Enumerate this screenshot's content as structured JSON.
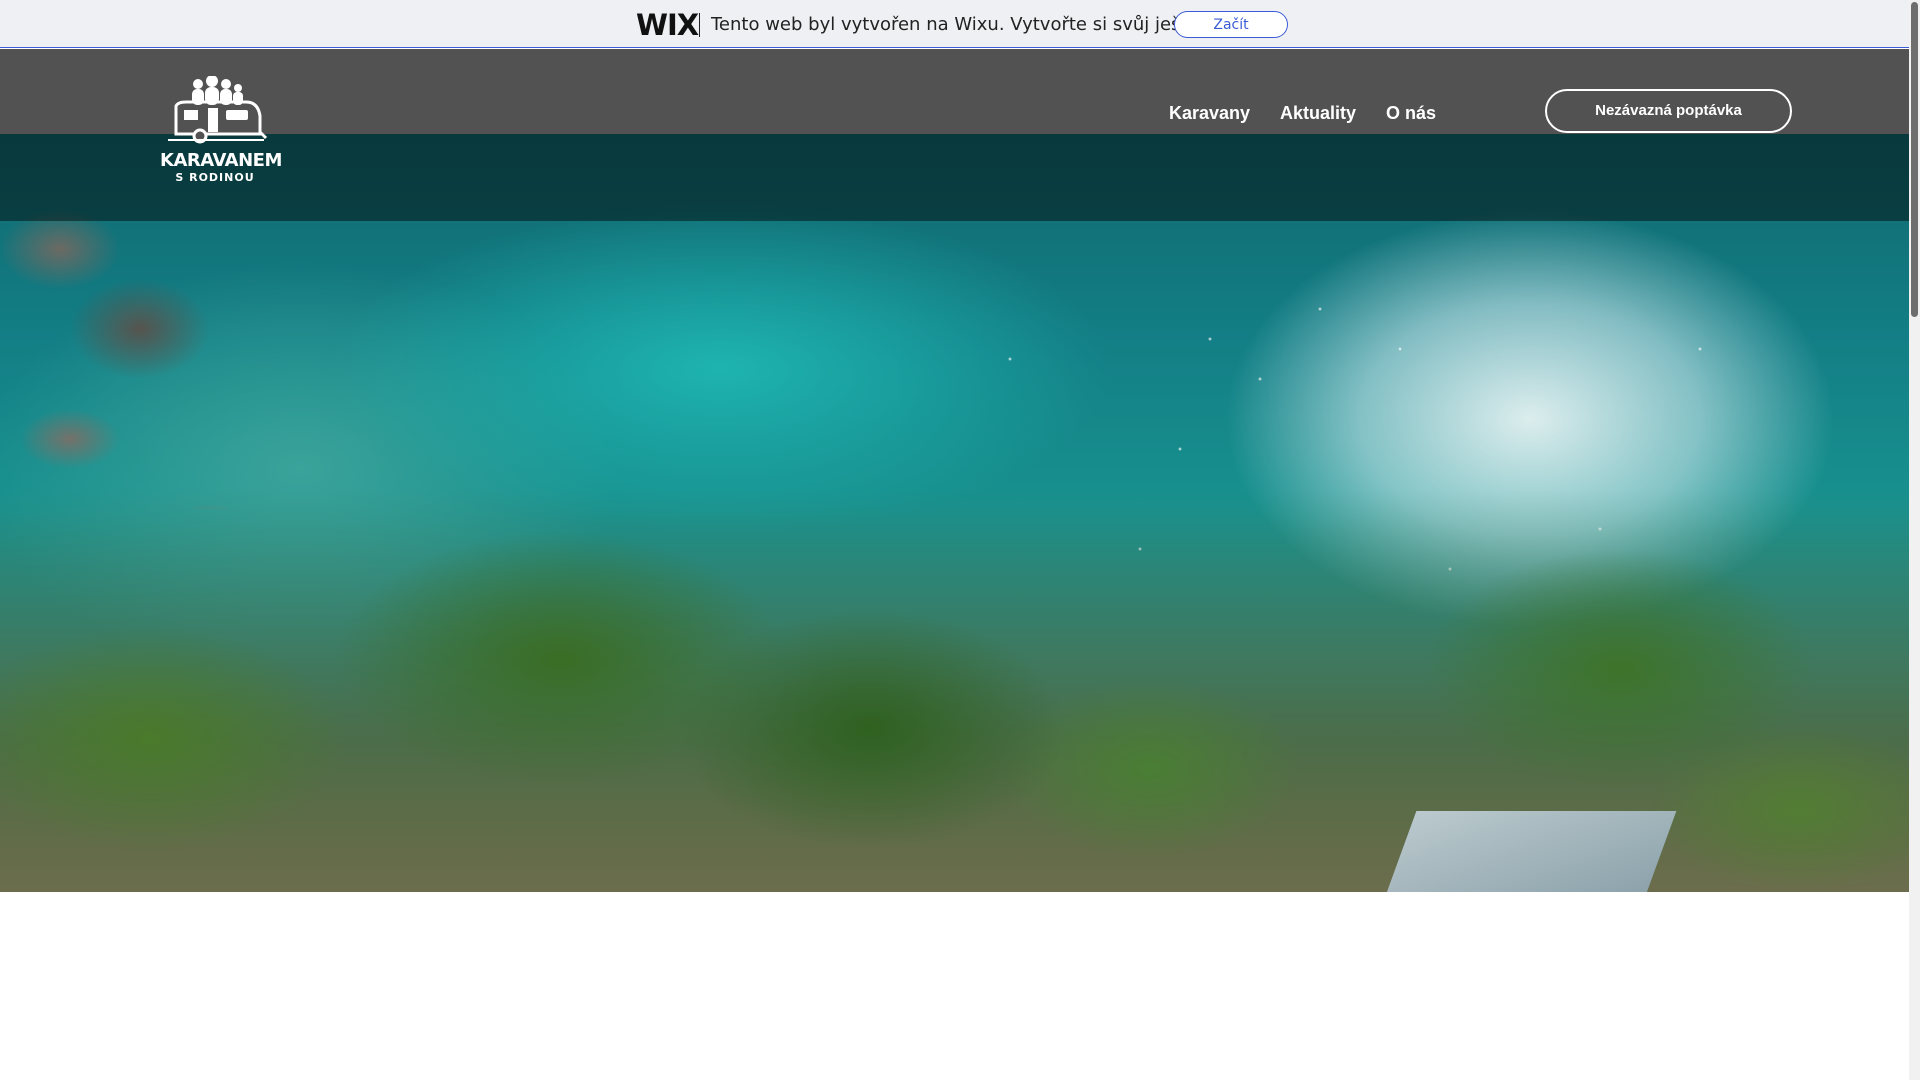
{
  "wix_banner": {
    "logo": "WIX",
    "message": "Tento web byl vytvořen na Wixu. Vytvořte si svůj ještě dnes.",
    "start_label": "Začít"
  },
  "header": {
    "logo_title": "KARAVANEM",
    "logo_subtitle": "S RODINOU",
    "nav": [
      "Karavany",
      "Aktuality",
      "O nás"
    ],
    "cta_label": "Nezávazná poptávka"
  },
  "colors": {
    "header_bg": "#525252",
    "wix_accent": "#3b5bd6",
    "banner_bg": "#eef0f3"
  },
  "icons": {
    "logo": "caravan-family-icon"
  }
}
